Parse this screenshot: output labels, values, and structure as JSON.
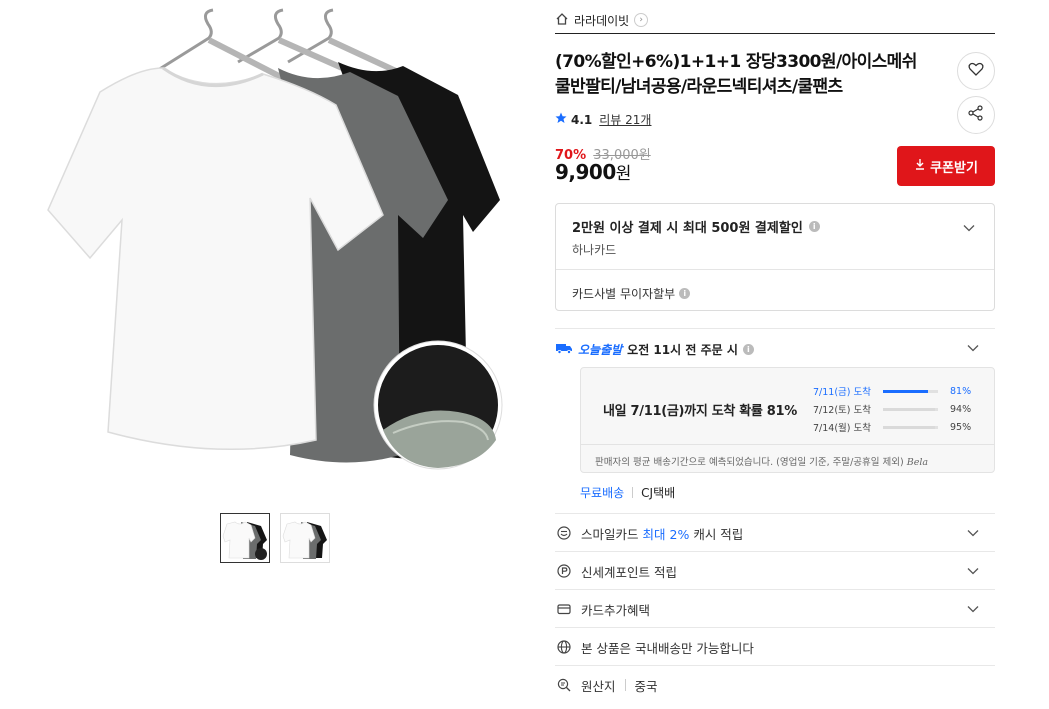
{
  "seller": {
    "name": "라라데이빗"
  },
  "product": {
    "title": "(70%할인+6%)1+1+1 장당3300원/아이스메쉬 쿨반팔티/남녀공용/라운드넥티셔츠/쿨팬츠",
    "rating": "4.1",
    "review_label": "리뷰 21개",
    "discount_rate": "70%",
    "original_price": "33,000원",
    "price": "9,900",
    "price_unit": "원"
  },
  "coupon": {
    "label": "쿠폰받기"
  },
  "card_promo": {
    "title": "2만원 이상 결제 시 최대 500원 결제할인",
    "card": "하나카드",
    "installment": "카드사별 무이자할부"
  },
  "shipping": {
    "brand": "오늘출발",
    "cutoff": "오전 11시 전 주문 시",
    "headline": "내일 7/11(금)까지 도착 확률 81%",
    "probabilities": [
      {
        "date": "7/11(금) 도착",
        "percent": "81%",
        "value": 81
      },
      {
        "date": "7/12(토) 도착",
        "percent": "94%",
        "value": 94
      },
      {
        "date": "7/14(월) 도착",
        "percent": "95%",
        "value": 95
      }
    ],
    "note": "판매자의 평균 배송기간으로 예측되었습니다. (영업일 기준, 주말/공휴일 제외)",
    "note_sign": "Bela",
    "free_label": "무료배송",
    "carrier": "CJ택배"
  },
  "benefits": {
    "smile_prefix": "스마일카드",
    "smile_highlight": "최대 2%",
    "smile_suffix": "캐시 적립",
    "point": "신세계포인트 적립",
    "card_extra": "카드추가혜택",
    "domestic": "본 상품은 국내배송만 가능합니다",
    "origin_label": "원산지",
    "origin_value": "중국"
  },
  "colors": {
    "accent_red": "#e0161a",
    "accent_blue": "#1a6dff"
  },
  "icons": [
    "home-icon",
    "heart-icon",
    "share-icon",
    "star-icon",
    "download-icon",
    "info-icon",
    "chevron-down-icon",
    "truck-icon",
    "smile-icon",
    "point-icon",
    "card-icon",
    "globe-icon",
    "search-icon"
  ]
}
